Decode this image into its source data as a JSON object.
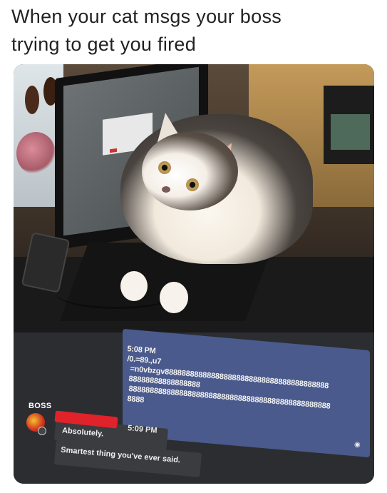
{
  "caption": {
    "line1": "When your cat msgs your boss",
    "line2": "trying to get you fired"
  },
  "chat": {
    "boss_label": "BOSS",
    "boss_message": {
      "time": "5:08 PM",
      "lines": [
        "/0.=89.,u7",
        "=n0vbzgv888888888888888888888888888888888888888",
        "88888888888888888",
        "888888888888888888888888888888888888888888888888",
        "8888"
      ]
    },
    "my_replies": {
      "time": "5:09 PM",
      "reply1": "Absolutely.",
      "reply2": "Smartest thing you've ever said."
    }
  }
}
